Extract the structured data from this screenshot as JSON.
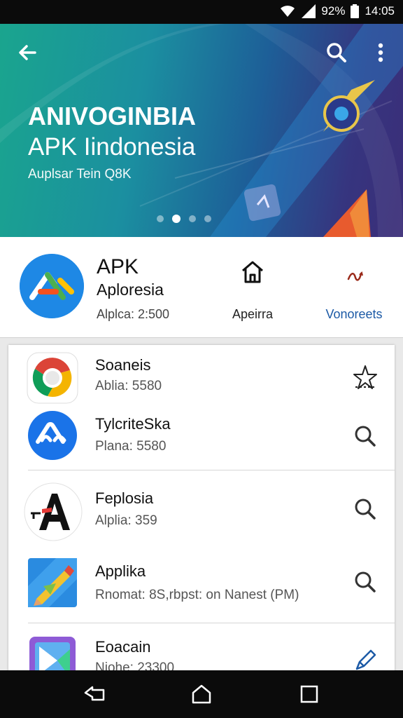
{
  "status_bar": {
    "battery": "92%",
    "time": "14:05"
  },
  "hero": {
    "title_line1": "ANIVOGINBIA",
    "title_line2": "APK Iindonesia",
    "subtitle": "Auplsar Tein Q8K",
    "slides": 4,
    "active_slide": 2
  },
  "app": {
    "name": "APK",
    "subtitle": "Aploresia",
    "meta": "Alplca: 2:500",
    "home_label": "Apeirra",
    "more_label": "Vonoreets"
  },
  "list": [
    {
      "title": "Soaneis",
      "meta": "Ablia: 5580",
      "action_icon": "star-icon"
    },
    {
      "title": "TylcriteSka",
      "meta": "Plana: 5580",
      "action_icon": "search-icon"
    },
    {
      "title": "Feplosia",
      "meta": "Alplia: 359",
      "action_icon": "search-icon"
    },
    {
      "title": "Applika",
      "meta": "Rnomat: 8S,rbpst: on Nanest (PM)",
      "action_icon": "search-icon"
    },
    {
      "title": "Eoacain",
      "meta": "Niohe: 23300",
      "action_icon": "pen-icon"
    }
  ],
  "colors": {
    "accent": "#1c5aa6",
    "hero_start": "#1aa58e",
    "hero_end": "#3b2d78"
  }
}
